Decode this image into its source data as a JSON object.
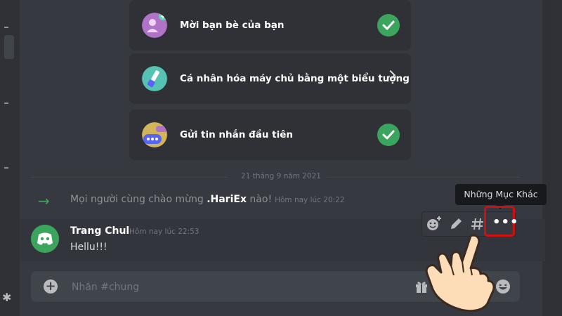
{
  "setup_cards": [
    {
      "label": "Mời bạn bè của bạn",
      "status": "done"
    },
    {
      "label": "Cá nhân hóa máy chủ bằng một biểu tượng",
      "status": "pending"
    },
    {
      "label": "Gửi tin nhắn đầu tiên",
      "status": "done"
    }
  ],
  "divider": {
    "date": "21 tháng 9 năm 2021"
  },
  "join_message": {
    "prefix": "Mọi người cùng chào mừng ",
    "username": ".HariEx",
    "suffix": " nào!",
    "timestamp": "Hôm nay lúc 20:22"
  },
  "message": {
    "author": "Trang Chul",
    "timestamp": "Hôm nay lúc 22:53",
    "content": "Hellu!!!"
  },
  "tooltip": {
    "text": "Những Mục Khác"
  },
  "message_toolbar": {
    "icons": [
      "add-reaction-icon",
      "edit-icon",
      "thread-icon",
      "more-options-icon"
    ]
  },
  "composer": {
    "placeholder": "Nhắn #chung"
  },
  "colors": {
    "background": "#36393f",
    "card": "#2f3136",
    "success_green": "#3ba55d",
    "highlight_red": "#d01010",
    "tooltip_bg": "#18191c"
  }
}
